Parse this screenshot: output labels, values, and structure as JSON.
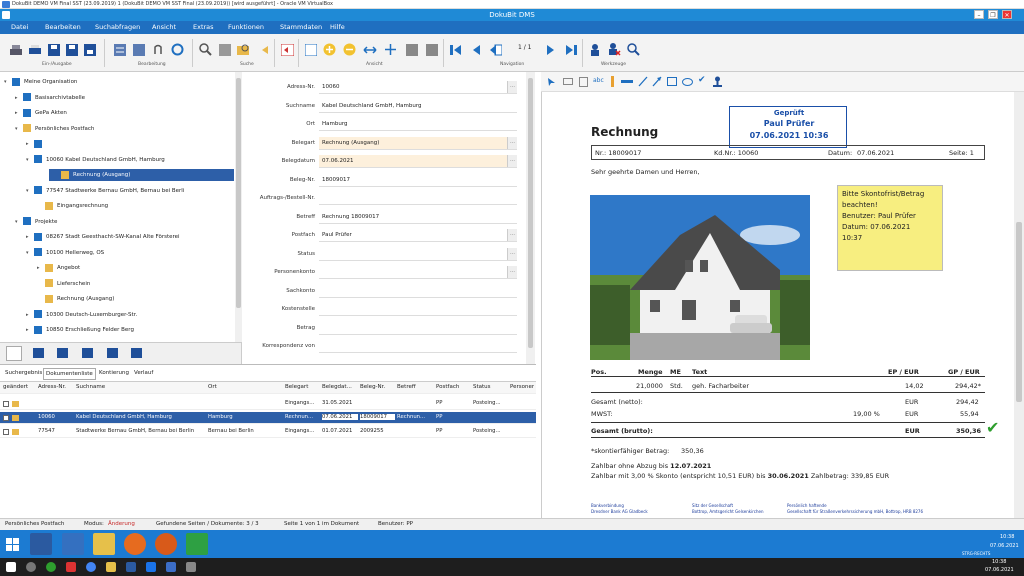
{
  "vbox_title": "DokuBit DEMO VM Final SST (23.09.2019) 1 (DokuBit DEMO VM SST Final (23.09.2019)) [wird ausgeführt] - Oracle VM VirtualBox",
  "app_title": "DokuBit DMS",
  "menu": [
    "Datei",
    "Bearbeiten",
    "Suchabfragen",
    "Ansicht",
    "Extras",
    "Funktionen",
    "Stammdaten",
    "Hilfe"
  ],
  "toolbar_groups": {
    "ein_ausgabe": "Ein-/Ausgabe",
    "bearbeitung": "Bearbeitung",
    "suche": "Suche",
    "ansicht": "Ansicht",
    "navigation": "Navigation",
    "werkzeuge": "Werkzeuge",
    "page_counter": "1 / 1"
  },
  "tree": [
    {
      "label": "Meine Organisation",
      "depth": 0,
      "toggle": "▾",
      "icon": "org-icon"
    },
    {
      "label": "Basisarchivtabelle",
      "depth": 1,
      "toggle": "▸",
      "icon": "table-icon"
    },
    {
      "label": "GePa Akten",
      "depth": 1,
      "toggle": "▸",
      "icon": "table-icon"
    },
    {
      "label": "Persönliches Postfach",
      "depth": 1,
      "toggle": "▾",
      "icon": "inbox-icon"
    },
    {
      "label": "",
      "depth": 2,
      "toggle": "▸",
      "icon": "file-icon"
    },
    {
      "label": "10060 Kabel Deutschland GmbH, Hamburg",
      "depth": 2,
      "toggle": "▾",
      "icon": "file-icon"
    },
    {
      "label": "Rechnung (Ausgang)",
      "depth": 3,
      "toggle": "",
      "icon": "folder-icon",
      "selected": true
    },
    {
      "label": "77547 Stadtwerke Bernau GmbH, Bernau bei Berli",
      "depth": 2,
      "toggle": "▾",
      "icon": "file-icon"
    },
    {
      "label": "Eingangsrechnung",
      "depth": 3,
      "toggle": "",
      "icon": "folder-icon"
    },
    {
      "label": "Projekte",
      "depth": 1,
      "toggle": "▾",
      "icon": "table-icon"
    },
    {
      "label": "08267 Stadt Geesthacht-SW-Kanal Alte Försterei",
      "depth": 2,
      "toggle": "▸",
      "icon": "file-icon"
    },
    {
      "label": "10100 Hellerweg, OS",
      "depth": 2,
      "toggle": "▾",
      "icon": "file-icon"
    },
    {
      "label": "Angebot",
      "depth": 3,
      "toggle": "▸",
      "icon": "folder-icon"
    },
    {
      "label": "Lieferschein",
      "depth": 3,
      "toggle": "",
      "icon": "folder-icon"
    },
    {
      "label": "Rechnung (Ausgang)",
      "depth": 3,
      "toggle": "",
      "icon": "folder-icon"
    },
    {
      "label": "10300 Deutsch-Luxemburger-Str.",
      "depth": 2,
      "toggle": "▸",
      "icon": "file-icon"
    },
    {
      "label": "10850 Erschließung Felder Berg",
      "depth": 2,
      "toggle": "▸",
      "icon": "file-icon"
    }
  ],
  "form": [
    {
      "label": "Adress-Nr.",
      "value": "10060",
      "btn": true
    },
    {
      "label": "Suchname",
      "value": "Kabel Deutschland GmbH, Hamburg"
    },
    {
      "label": "Ort",
      "value": "Hamburg"
    },
    {
      "label": "Belegart",
      "value": "Rechnung (Ausgang)",
      "hl": true,
      "btn": true
    },
    {
      "label": "Belegdatum",
      "value": "07.06.2021",
      "hl": true,
      "btn": true
    },
    {
      "label": "Beleg-Nr.",
      "value": "18009017"
    },
    {
      "label": "Auftrags-/Bestell-Nr.",
      "value": ""
    },
    {
      "label": "Betreff",
      "value": "Rechnung 18009017"
    },
    {
      "label": "Postfach",
      "value": "Paul Prüfer",
      "btn": true
    },
    {
      "label": "Status",
      "value": "",
      "btn": true
    },
    {
      "label": "Personenkonto",
      "value": "",
      "btn": true
    },
    {
      "label": "Sachkonto",
      "value": ""
    },
    {
      "label": "Kostenstelle",
      "value": ""
    },
    {
      "label": "Betrag",
      "value": ""
    },
    {
      "label": "Korrespondenz von",
      "value": ""
    }
  ],
  "content_tabs": [
    "Suchergebnis",
    "Dokumentenliste",
    "Kontierung",
    "Verlauf"
  ],
  "grid_headers": [
    "geändert",
    "Adress-Nr.",
    "Suchname",
    "Ort",
    "Belegart",
    "Belegdat...",
    "Beleg-Nr.",
    "Betreff",
    "Postfach",
    "Status",
    "Personen"
  ],
  "grid_rows": [
    {
      "cells": [
        "",
        "",
        "",
        "",
        "Eingangs...",
        "31.05.2021",
        "",
        "",
        "PP",
        "Posteing..."
      ]
    },
    {
      "cells": [
        "",
        "10060",
        "Kabel Deutschland GmbH, Hamburg",
        "Hamburg",
        "Rechnun...",
        "07.06.2021",
        "18009017",
        "Rechnun...",
        "PP",
        ""
      ],
      "selected": true
    },
    {
      "cells": [
        "",
        "77547",
        "Stadtwerke Bernau GmbH, Bernau bei Berlin",
        "Bernau bei Berlin",
        "Eingangs...",
        "01.07.2021",
        "2009255",
        "",
        "PP",
        "Posteing..."
      ]
    }
  ],
  "doc": {
    "heading": "Rechnung",
    "stamp": [
      "Geprüft",
      "Paul Prüfer",
      "07.06.2021 10:36"
    ],
    "nr": "Nr.: 18009017",
    "kdnr": "Kd.Nr.: 10060",
    "datum_label": "Datum:",
    "datum": "07.06.2021",
    "seite": "Seite: 1",
    "greeting": "Sehr geehrte Damen und Herren,",
    "note": [
      "Bitte Skontofrist/Betrag",
      "beachten!",
      "Benutzer: Paul Prüfer",
      "Datum: 07.06.2021",
      "10:37"
    ],
    "cols": [
      "Pos.",
      "Menge",
      "ME",
      "Text",
      "EP / EUR",
      "GP / EUR"
    ],
    "item": {
      "menge": "21,0000",
      "me": "Std.",
      "text": "geh. Facharbeiter",
      "ep": "14,02",
      "gp": "294,42*"
    },
    "netto": {
      "label": "Gesamt (netto):",
      "cur": "EUR",
      "val": "294,42"
    },
    "mwst": {
      "label": "MWST:",
      "pct": "19,00 %",
      "cur": "EUR",
      "val": "55,94"
    },
    "brutto": {
      "label": "Gesamt (brutto):",
      "cur": "EUR",
      "val": "350,36"
    },
    "skonto_label": "*skontierfähiger Betrag:",
    "skonto_val": "350,36",
    "line1_a": "Zahlbar ohne Abzug bis ",
    "line1_b": "12.07.2021",
    "line2_a": "Zahlbar mit 3,00 % Skonto (entspricht 10,51 EUR) bis ",
    "line2_b": "30.06.2021",
    "line2_c": " Zahlbetrag: 339,85 EUR",
    "footer": [
      [
        "Bankverbindung",
        "Dresdner Bank AG Gladbeck"
      ],
      [
        "Sitz der Gesellschaft",
        "Bottrop, Amtsgericht Gelsenkirchen"
      ],
      [
        "Persönlich haftende",
        "Gesellschaft für Straßenverkehrssicherung mbH, Bottrop, HRB 8276"
      ]
    ]
  },
  "status": {
    "postfach": "Persönliches Postfach",
    "modus_label": "Modus:",
    "modus": "Änderung",
    "found": "Gefundene Seiten / Dokumente:  3 / 3",
    "seite": "Seite 1 von 1 im Dokument",
    "benutzer": "Benutzer:  PP"
  },
  "vm_clock": [
    "10:38",
    "07.06.2021"
  ],
  "vm_kbd": "STRG-RECHTS",
  "host_clock": [
    "10:38",
    "07.06.2021"
  ],
  "colors": {
    "accent": "#1f6fc0",
    "selection": "#2d5fa8",
    "stamp": "#1a4fa8",
    "note": "#f7ee80",
    "check": "#2e9e2e"
  }
}
